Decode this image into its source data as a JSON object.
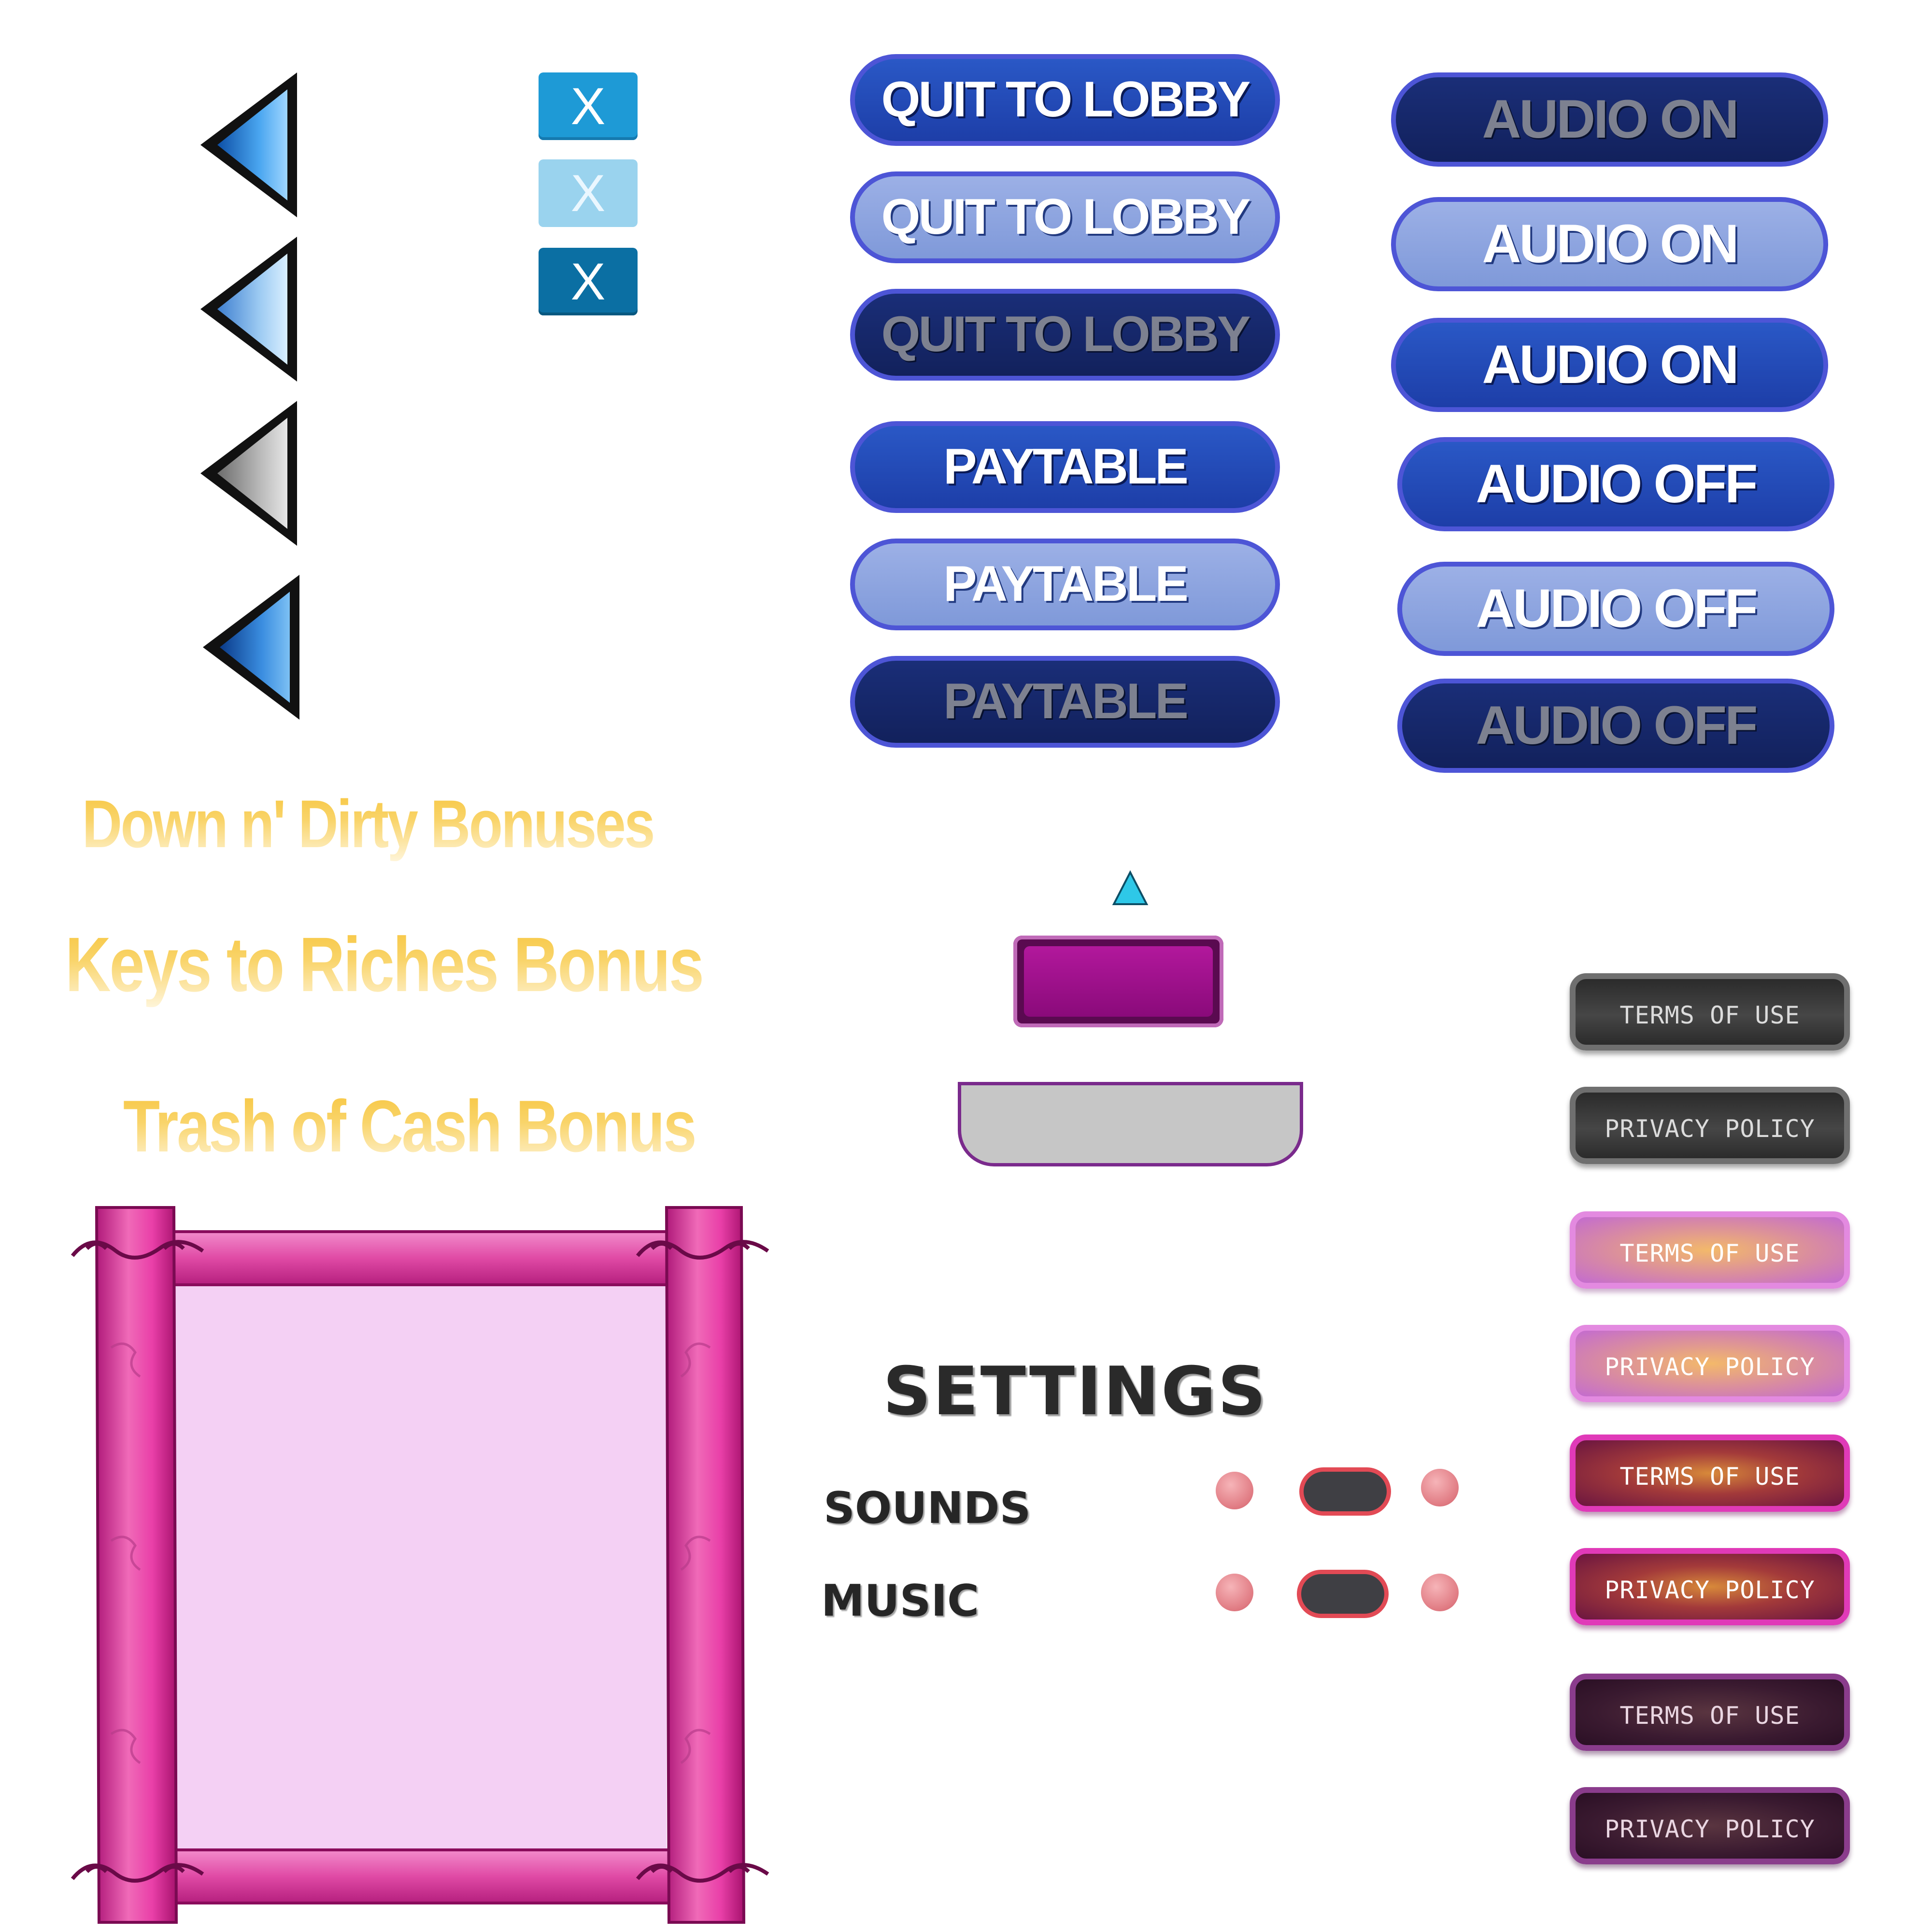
{
  "close_buttons": [
    {
      "label": "X",
      "state": "normal",
      "color": "#1e9ad6"
    },
    {
      "label": "X",
      "state": "hover",
      "color": "#9ad3ee"
    },
    {
      "label": "X",
      "state": "pressed",
      "color": "#0b6fa3"
    }
  ],
  "arrow_buttons": [
    {
      "icon": "left-arrow-icon",
      "state": "normal"
    },
    {
      "icon": "left-arrow-icon",
      "state": "hover"
    },
    {
      "icon": "left-arrow-icon",
      "state": "disabled"
    },
    {
      "icon": "left-arrow-icon",
      "state": "pressed"
    }
  ],
  "quit_buttons": [
    {
      "label": "QUIT TO LOBBY",
      "state": "normal"
    },
    {
      "label": "QUIT TO LOBBY",
      "state": "hover"
    },
    {
      "label": "QUIT TO LOBBY",
      "state": "disabled"
    }
  ],
  "paytable_buttons": [
    {
      "label": "PAYTABLE",
      "state": "normal"
    },
    {
      "label": "PAYTABLE",
      "state": "hover"
    },
    {
      "label": "PAYTABLE",
      "state": "disabled"
    }
  ],
  "audio_on_buttons": [
    {
      "label": "AUDIO ON",
      "state": "disabled"
    },
    {
      "label": "AUDIO ON",
      "state": "hover"
    },
    {
      "label": "AUDIO ON",
      "state": "normal"
    }
  ],
  "audio_off_buttons": [
    {
      "label": "AUDIO OFF",
      "state": "normal"
    },
    {
      "label": "AUDIO OFF",
      "state": "hover"
    },
    {
      "label": "AUDIO OFF",
      "state": "disabled"
    }
  ],
  "bonus_titles": [
    "Down  n'  Dirty  Bonuses",
    "Keys to Riches Bonus",
    "Trash of Cash Bonus"
  ],
  "settings": {
    "title": "SETTINGS",
    "rows": [
      {
        "label": "SOUNDS"
      },
      {
        "label": "MUSIC"
      }
    ]
  },
  "legal_buttons": [
    {
      "label": "TERMS OF USE",
      "style": "grey"
    },
    {
      "label": "PRIVACY POLICY",
      "style": "grey"
    },
    {
      "label": "TERMS OF USE",
      "style": "pink"
    },
    {
      "label": "PRIVACY POLICY",
      "style": "pink"
    },
    {
      "label": "TERMS OF USE",
      "style": "magenta"
    },
    {
      "label": "PRIVACY POLICY",
      "style": "magenta"
    },
    {
      "label": "TERMS OF USE",
      "style": "dark"
    },
    {
      "label": "PRIVACY POLICY",
      "style": "dark"
    }
  ],
  "colors": {
    "button_blue": "#1d3ea8",
    "button_border": "#4d55d6",
    "frame_pink": "#e83fa8",
    "frame_inner": "#f4d0f4",
    "gem_magenta": "#9a0f86",
    "toggle_red": "#e24a55",
    "marker_cyan": "#2ec8e8"
  }
}
